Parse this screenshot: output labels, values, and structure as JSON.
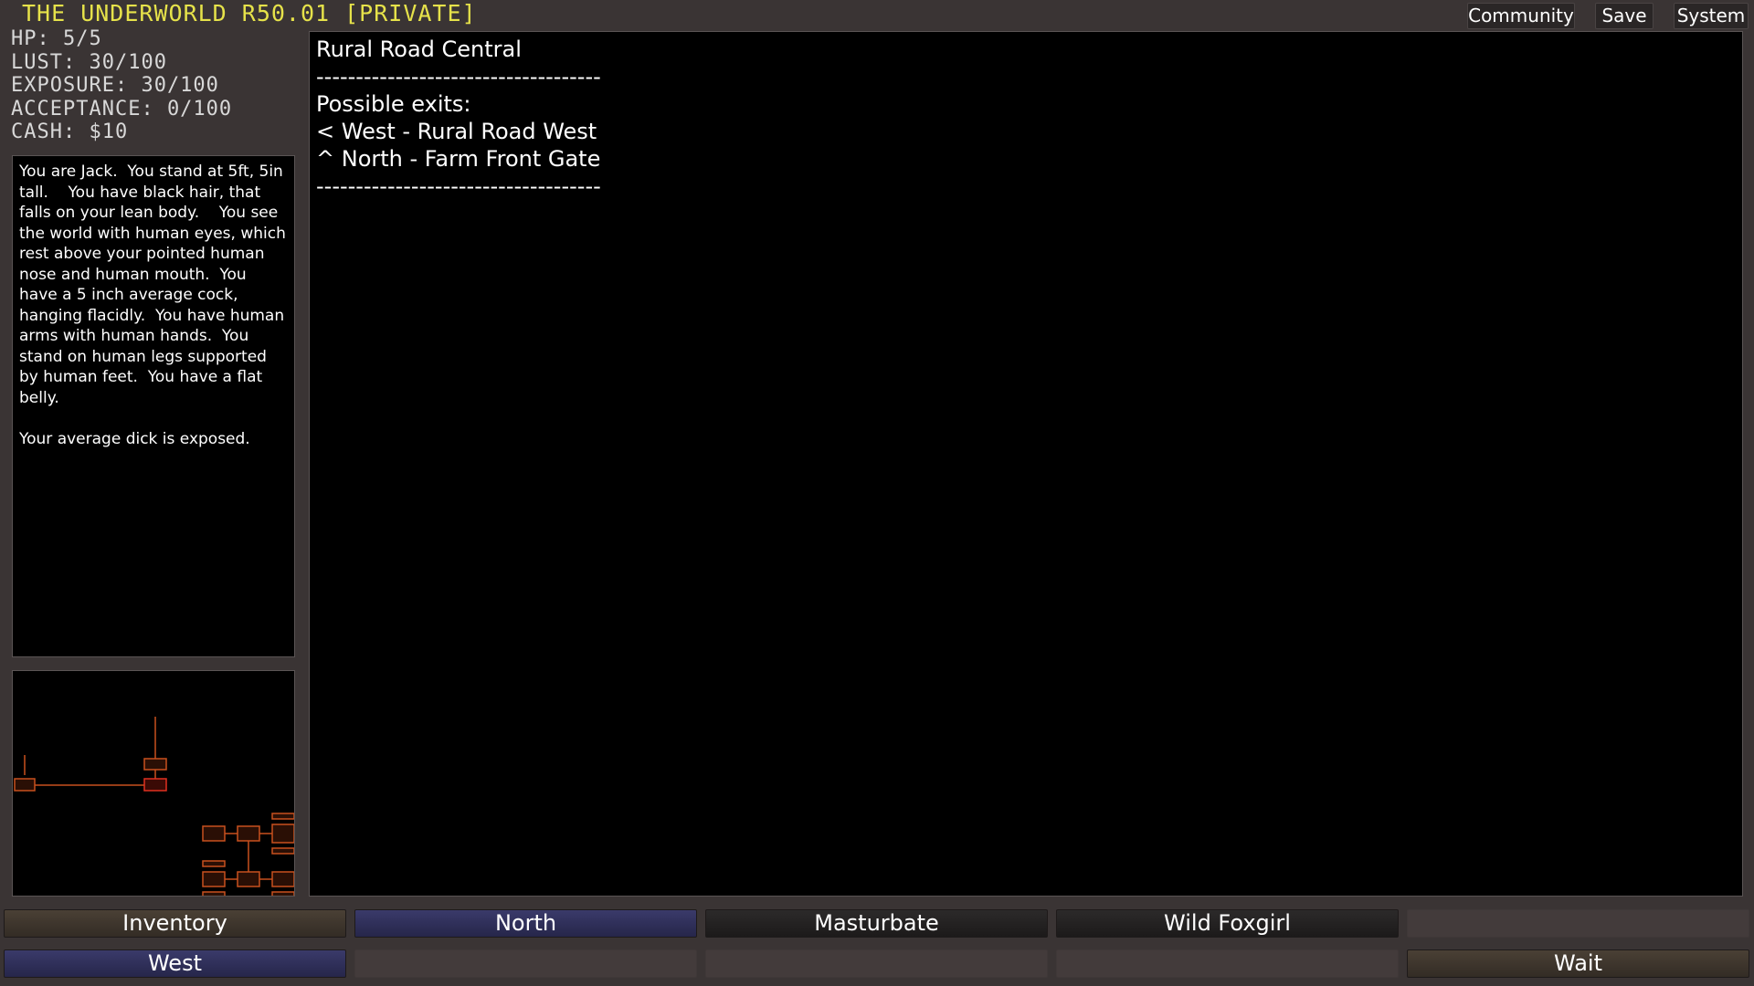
{
  "header": {
    "title": "THE UNDERWORLD R50.01 [PRIVATE]",
    "buttons": {
      "community": "Community",
      "save": "Save",
      "system": "System"
    }
  },
  "stats": [
    "HP: 5/5",
    "LUST: 30/100",
    "EXPOSURE: 30/100",
    "ACCEPTANCE: 0/100",
    "CASH: $10"
  ],
  "description": "You are Jack.  You stand at 5ft, 5in tall.    You have black hair, that falls on your lean body.    You see the world with human eyes, which rest above your pointed human nose and human mouth.  You have a 5 inch average cock, hanging flacidly.  You have human arms with human hands.  You stand on human legs supported by human feet.  You have a flat belly.\n\nYour average dick is exposed.",
  "main": {
    "location": "Rural Road Central",
    "divider": "------------------------------------",
    "exits_heading": "Possible exits:",
    "exits": [
      "< West - Rural Road West",
      "^ North - Farm Front Gate"
    ]
  },
  "actions": {
    "row1": [
      "Inventory",
      "North",
      "Masturbate",
      "Wild Foxgirl",
      ""
    ],
    "row2": [
      "West",
      "",
      "",
      "",
      "Wait"
    ]
  },
  "colors": {
    "title": "#e6e24a",
    "map_line": "#c8501e",
    "map_current": "#e03020"
  }
}
